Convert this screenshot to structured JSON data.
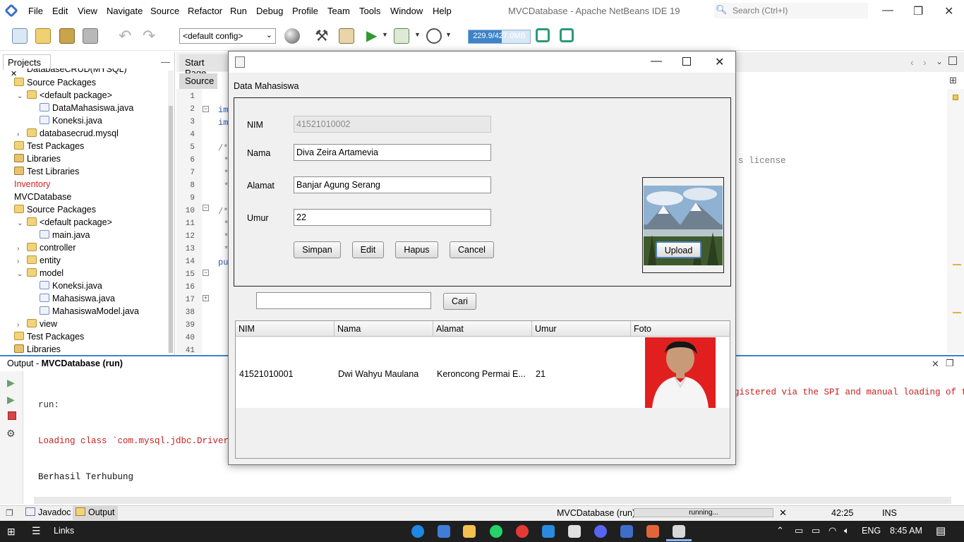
{
  "menubar": {
    "items": [
      "File",
      "Edit",
      "View",
      "Navigate",
      "Source",
      "Refactor",
      "Run",
      "Debug",
      "Profile",
      "Team",
      "Tools",
      "Window",
      "Help"
    ],
    "app_title": "MVCDatabase - Apache NetBeans IDE 19",
    "search_placeholder": "Search (Ctrl+I)"
  },
  "toolbar": {
    "config": "<default config>",
    "memory": "229.9/427.0MB",
    "memory_fraction": 0.538
  },
  "projects": {
    "tab_label": "Projects",
    "tree": [
      {
        "label": "DatabaseCRUD(MYSQL)",
        "indent": 1,
        "icon": "none",
        "exp": "",
        "cut": true
      },
      {
        "label": "Source Packages",
        "indent": 0,
        "icon": "pkg",
        "exp": ""
      },
      {
        "label": "<default package>",
        "indent": 1,
        "icon": "pkg",
        "exp": "⌄"
      },
      {
        "label": "DataMahasiswa.java",
        "indent": 2,
        "icon": "java",
        "exp": ""
      },
      {
        "label": "Koneksi.java",
        "indent": 2,
        "icon": "java",
        "exp": ""
      },
      {
        "label": "databasecrud.mysql",
        "indent": 1,
        "icon": "pkg",
        "exp": "›"
      },
      {
        "label": "Test Packages",
        "indent": 0,
        "icon": "pkg",
        "exp": ""
      },
      {
        "label": "Libraries",
        "indent": 0,
        "icon": "lib",
        "exp": ""
      },
      {
        "label": "Test Libraries",
        "indent": 0,
        "icon": "lib",
        "exp": ""
      },
      {
        "label": "Inventory",
        "indent": 0,
        "icon": "none",
        "exp": "",
        "red": true
      },
      {
        "label": "MVCDatabase",
        "indent": 0,
        "icon": "none",
        "exp": ""
      },
      {
        "label": "Source Packages",
        "indent": 0,
        "icon": "pkg",
        "exp": ""
      },
      {
        "label": "<default package>",
        "indent": 1,
        "icon": "pkg",
        "exp": "⌄"
      },
      {
        "label": "main.java",
        "indent": 2,
        "icon": "java",
        "exp": ""
      },
      {
        "label": "controller",
        "indent": 1,
        "icon": "pkg",
        "exp": "›"
      },
      {
        "label": "entity",
        "indent": 1,
        "icon": "pkg",
        "exp": "›"
      },
      {
        "label": "model",
        "indent": 1,
        "icon": "pkg",
        "exp": "⌄"
      },
      {
        "label": "Koneksi.java",
        "indent": 2,
        "icon": "java",
        "exp": ""
      },
      {
        "label": "Mahasiswa.java",
        "indent": 2,
        "icon": "java",
        "exp": ""
      },
      {
        "label": "MahasiswaModel.java",
        "indent": 2,
        "icon": "java",
        "exp": ""
      },
      {
        "label": "view",
        "indent": 1,
        "icon": "pkg",
        "exp": "›"
      },
      {
        "label": "Test Packages",
        "indent": 0,
        "icon": "pkg",
        "exp": ""
      },
      {
        "label": "Libraries",
        "indent": 0,
        "icon": "lib",
        "exp": ""
      }
    ]
  },
  "editor": {
    "start_page_tab": "Start Page",
    "source_tab": "Source",
    "line_numbers": [
      "1",
      "2",
      "3",
      "4",
      "5",
      "6",
      "7",
      "8",
      "9",
      "10",
      "11",
      "12",
      "13",
      "14",
      "15",
      "16",
      "17",
      "38",
      "39",
      "40",
      "41"
    ],
    "code_fragments": [
      "im",
      "im",
      "/*",
      "*",
      "*",
      "*",
      "/*",
      "*",
      "*",
      "*",
      "pu"
    ],
    "license_text": "s license"
  },
  "output": {
    "title": "Output - ",
    "title_bold": "MVCDatabase (run)",
    "line_run": "run:",
    "line_loading": "Loading class `com.mysql.jdbc.Driver'.",
    "line_loading_tail": "gistered via the SPI and manual loading of th",
    "line_connected": "Berhasil Terhubung"
  },
  "statusbar": {
    "javadoc_tab": "Javadoc",
    "output_tab": "Output",
    "run_label": "MVCDatabase (run)",
    "progress_text": "running...",
    "position": "42:25",
    "mode": "INS"
  },
  "taskbar": {
    "links": "Links",
    "lang": "ENG",
    "time": "8:45 AM"
  },
  "dialog": {
    "caption": "Data Mahasiswa",
    "labels": {
      "nim": "NIM",
      "nama": "Nama",
      "alamat": "Alamat",
      "umur": "Umur"
    },
    "values": {
      "nim": "41521010002",
      "nama": "Diva Zeira Artamevia",
      "alamat": "Banjar Agung Serang",
      "umur": "22"
    },
    "buttons": {
      "simpan": "Simpan",
      "edit": "Edit",
      "hapus": "Hapus",
      "cancel": "Cancel",
      "upload": "Upload",
      "cari": "Cari"
    },
    "search_value": "",
    "table": {
      "columns": [
        "NIM",
        "Nama",
        "Alamat",
        "Umur",
        "Foto"
      ],
      "rows": [
        {
          "nim": "41521010001",
          "nama": "Dwi Wahyu Maulana",
          "alamat": "Keroncong Permai E...",
          "umur": "21"
        }
      ]
    }
  }
}
